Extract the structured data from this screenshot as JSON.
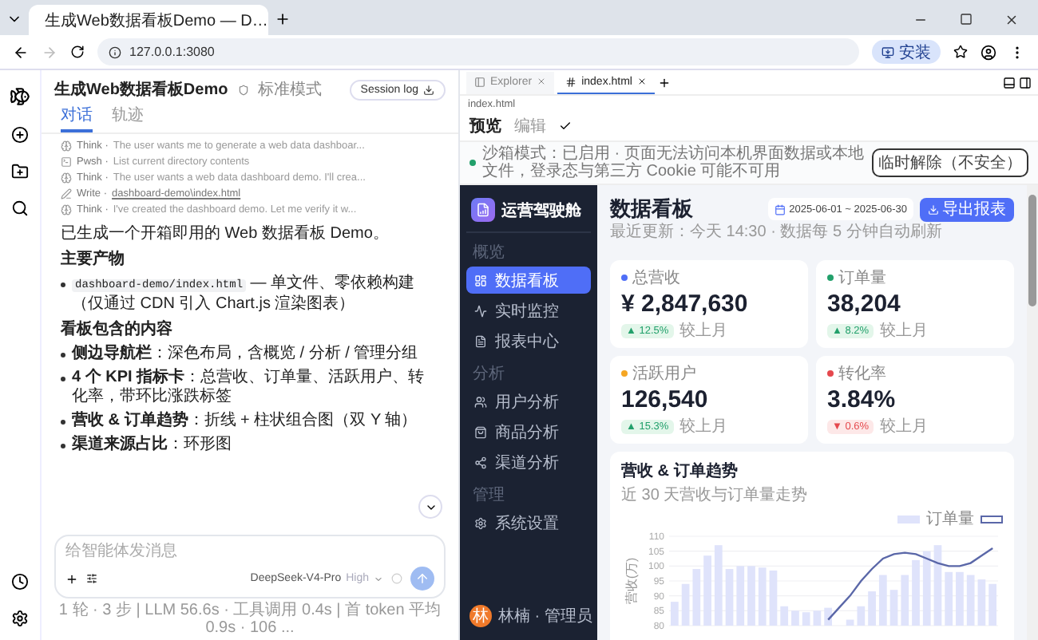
{
  "browser": {
    "tab_title": "生成Web数据看板Demo — D…",
    "url": "127.0.0.1:3080",
    "install_label": "安装"
  },
  "chat": {
    "title": "生成Web数据看板Demo",
    "mode": "标准模式",
    "session_button": "Session log",
    "tabs": [
      {
        "label": "对话",
        "selected": true
      },
      {
        "label": "轨迹",
        "selected": false
      }
    ],
    "steps": [
      {
        "kind": "think",
        "tool": "Think ·",
        "text": "The user wants me to generate a web data dashboar..."
      },
      {
        "kind": "shell",
        "tool": "Pwsh ·",
        "text": "List current directory contents"
      },
      {
        "kind": "think",
        "tool": "Think ·",
        "text": "The user wants a web data dashboard demo. I'll crea..."
      },
      {
        "kind": "write",
        "tool": "Write ·",
        "text": "dashboard-demo\\index.html"
      },
      {
        "kind": "think",
        "tool": "Think ·",
        "text": "I've created the dashboard demo. Let me verify it w..."
      }
    ],
    "message": [
      {
        "kind": "paragraph",
        "text": "已生成一个开箱即用的 Web 数据看板 Demo。"
      },
      {
        "kind": "heading",
        "text": "主要产物"
      },
      {
        "kind": "code_bullet",
        "code": "dashboard-demo/index.html",
        "text": " — 单文件、零依赖构建（仅通过 CDN 引入 Chart.js 渲染图表）"
      },
      {
        "kind": "heading",
        "text": "看板包含的内容"
      },
      {
        "kind": "bullet",
        "text": "**侧边导航栏**：深色布局，含概览 / 分析 / 管理分组"
      },
      {
        "kind": "bullet",
        "text": "**4 个 KPI 指标卡**：总营收、订单量、活跃用户、转化率，带环比涨跌标签"
      },
      {
        "kind": "bullet",
        "text": "**营收 & 订单趋势**：折线 + 柱状组合图（双 Y 轴）"
      },
      {
        "kind": "bullet",
        "text": "**渠道来源占比**：环形图"
      }
    ],
    "input": {
      "placeholder": "给智能体发消息"
    },
    "model": "DeepSeek-V4-Pro",
    "effort": "High",
    "footer": "1 轮 · 3 步 | LLM 56.6s · 工具调用 0.4s | 首 token 平均 0.9s · 106 ..."
  },
  "editor": {
    "tabs": [
      {
        "label": "Explorer",
        "selected": false
      },
      {
        "label": "index.html",
        "selected": true
      }
    ],
    "path": "index.html",
    "modes": [
      {
        "label": "预览",
        "selected": true
      },
      {
        "label": "编辑",
        "selected": false
      }
    ],
    "notice": "沙箱模式：已启用 · 页面无法访问本机界面数据或本地文件，登录态与第三方 Cookie 可能不可用",
    "unsafe_button": "临时解除（不安全）"
  },
  "dashboard": {
    "brand": "运营驾驶舱",
    "nav": [
      {
        "title": "概览",
        "items": [
          {
            "label": "数据看板",
            "selected": true
          },
          {
            "label": "实时监控",
            "selected": false
          },
          {
            "label": "报表中心",
            "selected": false
          }
        ]
      },
      {
        "title": "分析",
        "items": [
          {
            "label": "用户分析",
            "selected": false
          },
          {
            "label": "商品分析",
            "selected": false
          },
          {
            "label": "渠道分析",
            "selected": false
          }
        ]
      },
      {
        "title": "管理",
        "items": [
          {
            "label": "系统设置",
            "selected": false
          }
        ]
      }
    ],
    "user": {
      "avatar": "林",
      "name": "林楠 · 管理员"
    },
    "title": "数据看板",
    "subtitle": "最近更新：今天 14:30 · 数据每 5 分钟自动刷新",
    "date_range": "2025-06-01 ~ 2025-06-30",
    "export_button": "导出报表",
    "kpis": [
      {
        "label": "总营收",
        "value": "¥ 2,847,630",
        "change": "▲ 12.5%",
        "kind": "up",
        "note": "较上月",
        "color": "#4f6ef7"
      },
      {
        "label": "订单量",
        "value": "38,204",
        "change": "▲ 8.2%",
        "kind": "up",
        "note": "较上月",
        "color": "#22a06b"
      },
      {
        "label": "活跃用户",
        "value": "126,540",
        "change": "▲ 15.3%",
        "kind": "up",
        "note": "较上月",
        "color": "#f5a623"
      },
      {
        "label": "转化率",
        "value": "3.84%",
        "change": "▼ 0.6%",
        "kind": "down",
        "note": "较上月",
        "color": "#e5484d"
      }
    ],
    "trend_card": {
      "title": "营收 & 订单趋势",
      "subtitle": "近 30 天营收与订单量走势",
      "chart_data": {
        "type": "bar",
        "grid": true,
        "ylabel": "营收(万)",
        "ylim": [
          80,
          110
        ],
        "yticks": [
          80,
          85,
          90,
          95,
          100,
          105,
          110
        ],
        "series": [
          {
            "name": "订单量",
            "color": "#dfe3fb",
            "values": [
              88,
              94,
              99,
              103.5,
              107,
              99,
              100,
              100,
              99.5,
              98.5,
              86.5,
              85,
              84.5,
              85,
              86,
              null,
              82,
              86.5,
              91.5,
              97,
              92,
              97,
              102,
              105,
              107,
              98,
              98,
              97,
              95.5,
              94
            ]
          },
          {
            "type": "line",
            "color": "#5a67a8",
            "values": [
              null,
              null,
              null,
              null,
              null,
              null,
              null,
              null,
              null,
              null,
              null,
              null,
              null,
              null,
              82,
              86,
              90,
              95,
              99,
              102.5,
              104,
              104.5,
              104,
              102.5,
              101,
              100,
              100,
              101,
              103.5,
              106
            ]
          }
        ]
      }
    }
  }
}
